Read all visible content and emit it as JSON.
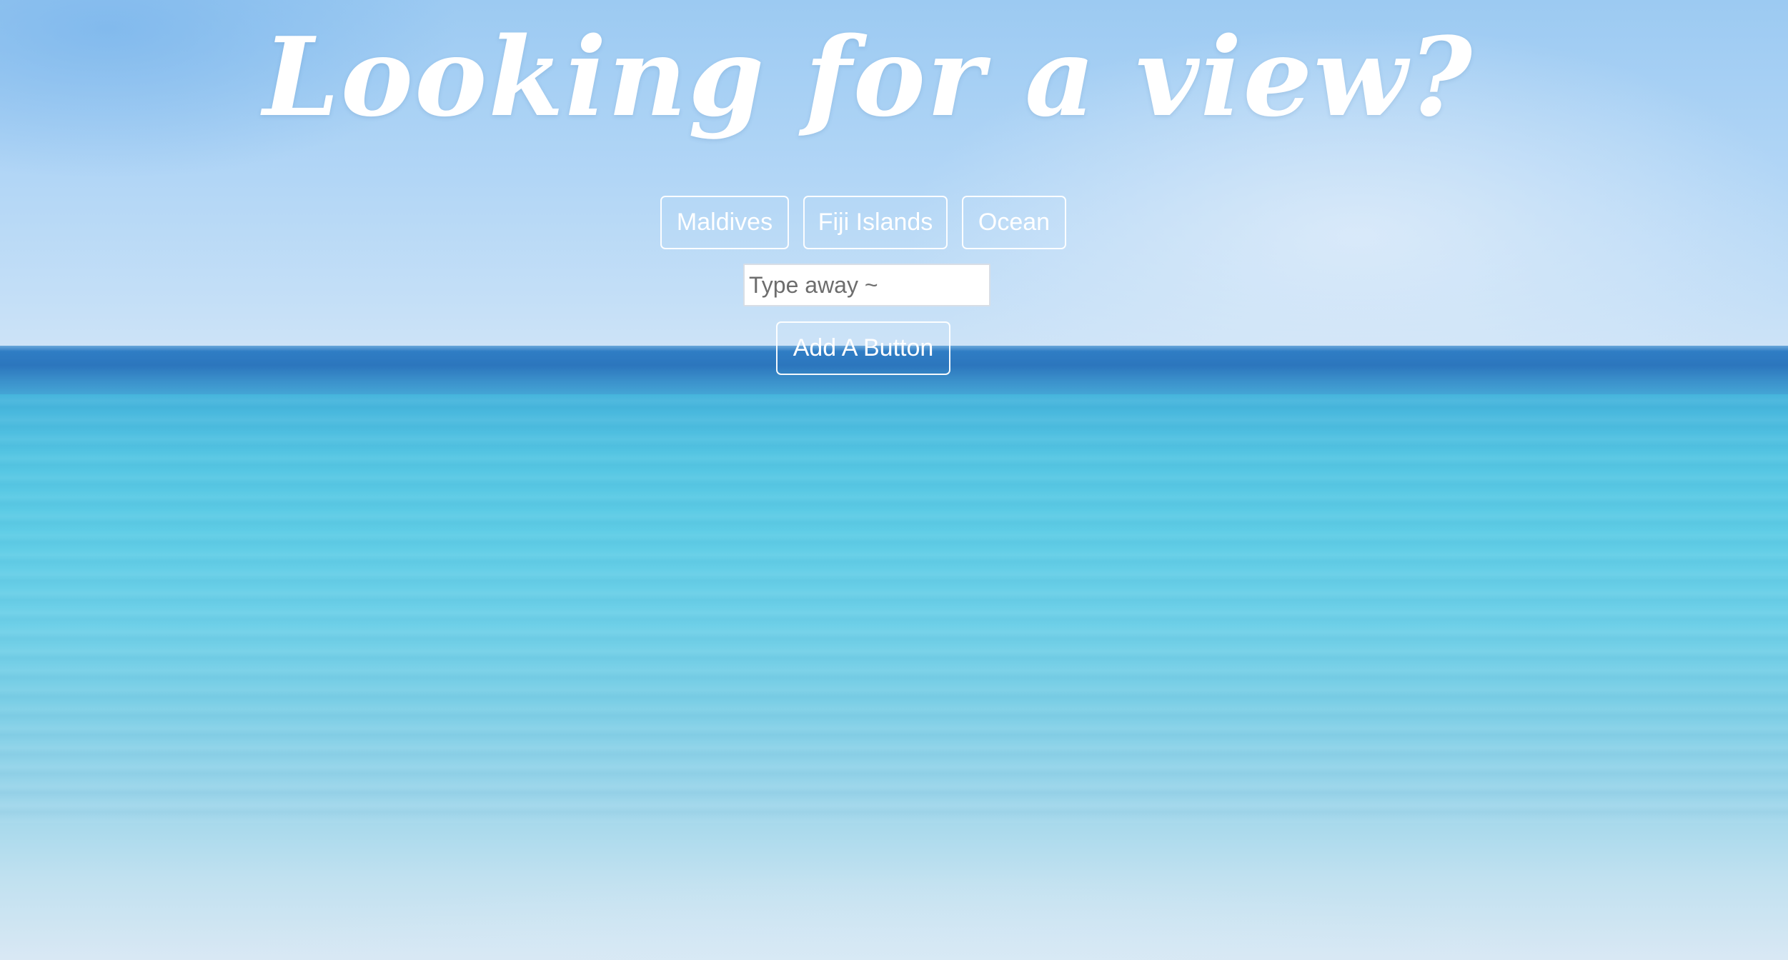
{
  "page": {
    "title": "Looking for a view?"
  },
  "view_buttons": [
    {
      "label": "Maldives"
    },
    {
      "label": "Fiji Islands"
    },
    {
      "label": "Ocean"
    }
  ],
  "new_button": {
    "placeholder": "Type away ~",
    "value": "",
    "add_label": "Add A Button"
  },
  "colors": {
    "sky": "#b2d6f6",
    "horizon": "#2c76bd",
    "sea": "#5fcde6",
    "text": "#ffffff"
  }
}
